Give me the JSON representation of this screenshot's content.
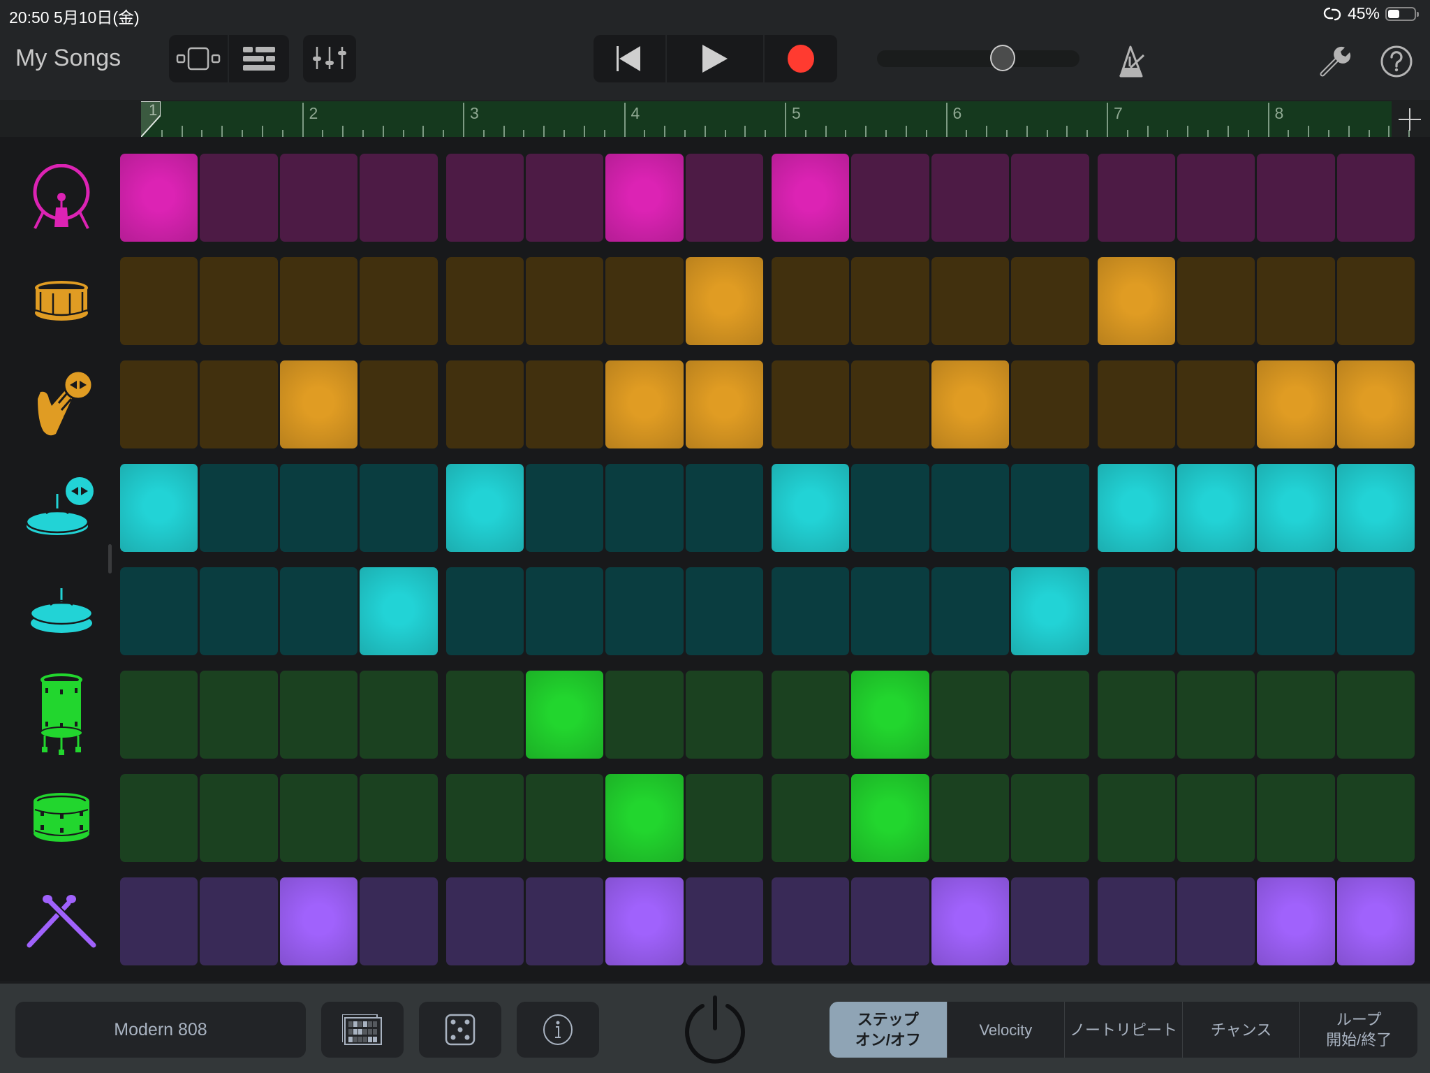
{
  "status_bar": {
    "time_date": "20:50   5月10日(金)",
    "battery_text": "45%",
    "battery_level": 0.45
  },
  "toolbar": {
    "my_songs_label": "My Songs",
    "view_buttons": [
      "live-loops-view-icon",
      "tracks-view-icon"
    ],
    "mixer_icon": "mixer-sliders-icon",
    "transport": [
      "rewind-icon",
      "play-icon",
      "record-icon"
    ],
    "tempo_slider_value": 0.62,
    "metronome_icon": "metronome-icon",
    "settings_icon": "wrench-icon",
    "help_icon": "help-icon"
  },
  "ruler": {
    "bars": [
      "1",
      "2",
      "3",
      "4",
      "5",
      "6",
      "7",
      "8"
    ],
    "add_icon": "plus-icon"
  },
  "colors": {
    "kick_on": "#dc23b4",
    "kick_off": "#4d1b45",
    "orange_on": "#e09c23",
    "orange_off": "#41300e",
    "cyan_on": "#22d3d6",
    "cyan_off": "#0a3d40",
    "green_on": "#22d62e",
    "green_off": "#1b4120",
    "purple_on": "#a062fc",
    "purple_off": "#392a57",
    "record": "#ff3b30",
    "mode_active_bg": "#8fa4b5"
  },
  "tracks": [
    {
      "name": "kick-drum",
      "icon": "kick-drum-icon",
      "color": "kick",
      "steps": [
        1,
        0,
        0,
        0,
        0,
        0,
        1,
        0,
        1,
        0,
        0,
        0,
        0,
        0,
        0,
        0
      ]
    },
    {
      "name": "snare",
      "icon": "snare-drum-icon",
      "color": "orange",
      "steps": [
        0,
        0,
        0,
        0,
        0,
        0,
        0,
        1,
        0,
        0,
        0,
        0,
        1,
        0,
        0,
        0
      ]
    },
    {
      "name": "clap",
      "icon": "hand-clap-icon",
      "color": "orange",
      "steps": [
        0,
        0,
        1,
        0,
        0,
        0,
        1,
        1,
        0,
        0,
        1,
        0,
        0,
        0,
        1,
        1
      ]
    },
    {
      "name": "open-hihat",
      "icon": "open-hihat-icon",
      "color": "cyan",
      "steps": [
        1,
        0,
        0,
        0,
        1,
        0,
        0,
        0,
        1,
        0,
        0,
        0,
        1,
        1,
        1,
        1
      ]
    },
    {
      "name": "closed-hihat",
      "icon": "closed-hihat-icon",
      "color": "cyan",
      "steps": [
        0,
        0,
        0,
        1,
        0,
        0,
        0,
        0,
        0,
        0,
        0,
        1,
        0,
        0,
        0,
        0
      ]
    },
    {
      "name": "floor-tom",
      "icon": "floor-tom-icon",
      "color": "green",
      "steps": [
        0,
        0,
        0,
        0,
        0,
        1,
        0,
        0,
        0,
        1,
        0,
        0,
        0,
        0,
        0,
        0
      ]
    },
    {
      "name": "tom",
      "icon": "tom-drum-icon",
      "color": "green",
      "steps": [
        0,
        0,
        0,
        0,
        0,
        0,
        1,
        0,
        0,
        1,
        0,
        0,
        0,
        0,
        0,
        0
      ]
    },
    {
      "name": "sticks",
      "icon": "drumsticks-icon",
      "color": "purple",
      "steps": [
        0,
        0,
        1,
        0,
        0,
        0,
        1,
        0,
        0,
        0,
        1,
        0,
        0,
        0,
        1,
        1
      ]
    }
  ],
  "bottom_bar": {
    "kit_name": "Modern 808",
    "pattern_icon": "pattern-grid-icon",
    "random_icon": "dice-icon",
    "info_icon": "info-icon",
    "power_icon": "power-icon",
    "modes": [
      {
        "label": "ステップ\nオン/オフ",
        "active": true
      },
      {
        "label": "Velocity",
        "active": false
      },
      {
        "label": "ノートリピート",
        "active": false
      },
      {
        "label": "チャンス",
        "active": false
      },
      {
        "label": "ループ\n開始/終了",
        "active": false
      }
    ]
  }
}
